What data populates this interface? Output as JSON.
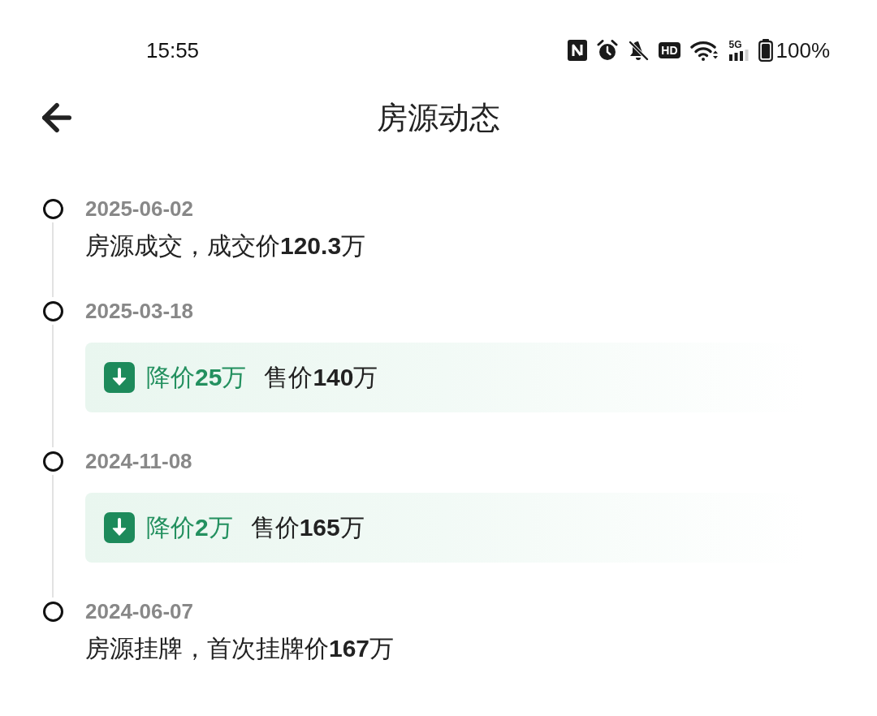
{
  "status_bar": {
    "time": "15:55",
    "hd_label": "HD",
    "network_label": "5G",
    "battery": "100%"
  },
  "header": {
    "title": "房源动态"
  },
  "timeline": [
    {
      "kind": "event",
      "date": "2025-06-02",
      "text": "房源成交，成交价**120.3**万"
    },
    {
      "kind": "price_drop",
      "date": "2025-03-18",
      "change": "降价**25**万",
      "price": "售价**140**万"
    },
    {
      "kind": "price_drop",
      "date": "2024-11-08",
      "change": "降价**2**万",
      "price": "售价**165**万"
    },
    {
      "kind": "event",
      "date": "2024-06-07",
      "text": "房源挂牌，首次挂牌价**167**万"
    }
  ]
}
